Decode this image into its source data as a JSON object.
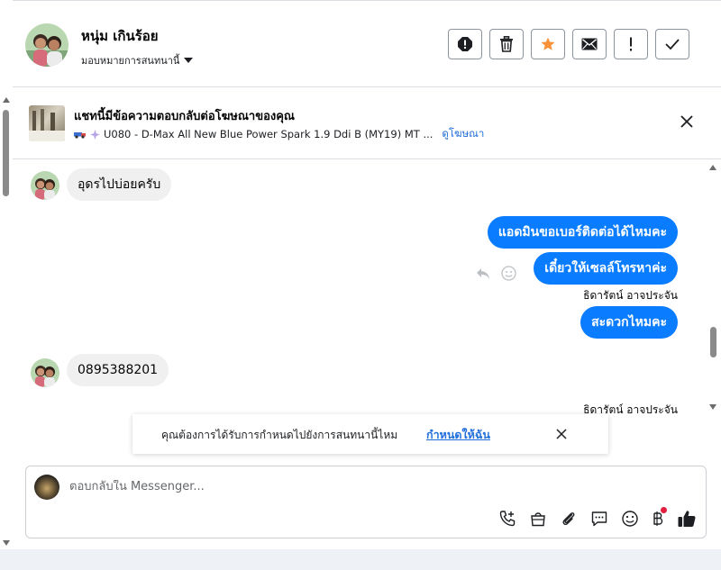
{
  "header": {
    "contact_name": "หนุ่ม เกินร้อย",
    "assign_label": "มอบหมายการสนทนานี้",
    "actions": [
      "spam-icon",
      "trash-icon",
      "star-icon",
      "envelope-icon",
      "exclamation-icon",
      "check-icon"
    ],
    "star_color": "#f7923a"
  },
  "ad": {
    "title": "แชทนี้มีข้อความตอบกลับต่อโฆษณาของคุณ",
    "subtitle": "U080 - D-Max All New Blue Power Spark 1.9 Ddi B (MY19) MT ...",
    "link": "ดูโฆษณา"
  },
  "messages": [
    {
      "side": "in",
      "text": "อุดรไปบ่อยครับ"
    },
    {
      "side": "out",
      "text": "แอดมินขอเบอร์ติดต่อได้ไหมคะ"
    },
    {
      "side": "out",
      "text": "เดี๋ยวให้เซลล์โทรหาค่ะ",
      "sender": "ธิดารัตน์ อาจประจัน"
    },
    {
      "side": "out",
      "text": "สะดวกไหมคะ"
    },
    {
      "side": "in",
      "text": "0895388201"
    }
  ],
  "trailing_sender": "ธิดารัตน์ อาจประจัน",
  "toast": {
    "text": "คุณต้องการได้รับการกำหนดไปยังการสนทนานี้ไหม",
    "link": "กำหนดให้ฉัน"
  },
  "composer": {
    "placeholder": "ตอบกลับใน Messenger...",
    "tools": [
      "call-add-icon",
      "shop-bag-icon",
      "paperclip-icon",
      "chat-bubble-icon",
      "emoji-icon",
      "baht-icon",
      "like-icon"
    ]
  },
  "colors": {
    "accent": "#0a7cff",
    "link": "#216fdb",
    "notification": "#e41e3f"
  }
}
